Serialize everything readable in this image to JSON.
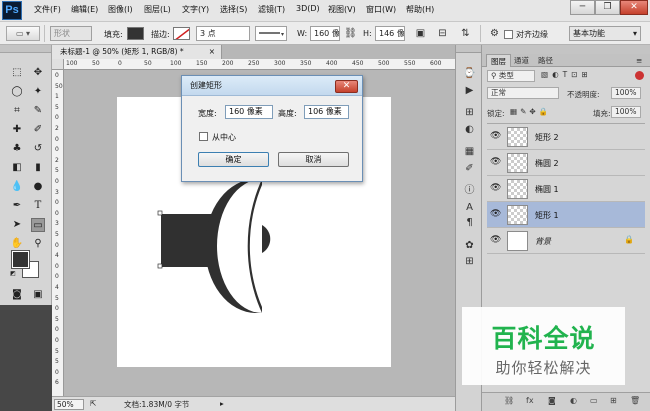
{
  "app": {
    "logo": "Ps"
  },
  "menu": [
    "文件(F)",
    "编辑(E)",
    "图像(I)",
    "图层(L)",
    "文字(Y)",
    "选择(S)",
    "滤镜(T)",
    "3D(D)",
    "视图(V)",
    "窗口(W)",
    "帮助(H)"
  ],
  "window_controls": {
    "minimize": "─",
    "restore": "❐",
    "close": "✕"
  },
  "options": {
    "shape_mode": "形状",
    "fill_label": "填充:",
    "stroke_label": "描边:",
    "stroke_width": "3 点",
    "w_label": "W:",
    "w_value": "160 像",
    "h_label": "H:",
    "h_value": "146 像",
    "align_edges": "对齐边缘",
    "workspace": "基本功能"
  },
  "document": {
    "tab_title": "未标题-1 @ 50% (矩形 1, RGB/8) *",
    "ruler_h": [
      "100",
      "50",
      "0",
      "50",
      "100",
      "150",
      "200",
      "250",
      "300",
      "350",
      "400",
      "450",
      "500",
      "550",
      "600"
    ],
    "ruler_v": [
      "0",
      "50",
      "1",
      "5",
      "0",
      "2",
      "0",
      "0",
      "2",
      "5",
      "0",
      "3",
      "0",
      "0",
      "3",
      "5",
      "0",
      "4",
      "0",
      "0",
      "4",
      "5",
      "0",
      "5",
      "0",
      "0",
      "5",
      "5",
      "0",
      "6"
    ],
    "zoom": "50%",
    "doc_info": "文档:1.83M/0 字节"
  },
  "dialog": {
    "title": "创建矩形",
    "width_label": "宽度:",
    "width_value": "160 像素",
    "height_label": "高度:",
    "height_value": "106 像素",
    "from_center_label": "从中心",
    "ok_label": "确定",
    "cancel_label": "取消",
    "close_glyph": "✕"
  },
  "layers_panel": {
    "tabs": [
      "图层",
      "通道",
      "路径"
    ],
    "kind_label": "类型",
    "blend_mode": "正常",
    "opacity_label": "不透明度:",
    "opacity_value": "100%",
    "lock_label": "锁定:",
    "fill_label": "填充:",
    "fill_value": "100%",
    "layers": [
      {
        "name": "矩形 2",
        "selected": false,
        "locked": false
      },
      {
        "name": "椭圆 2",
        "selected": false,
        "locked": false
      },
      {
        "name": "椭圆 1",
        "selected": false,
        "locked": false
      },
      {
        "name": "矩形 1",
        "selected": true,
        "locked": false
      },
      {
        "name": "背景",
        "selected": false,
        "locked": true
      }
    ]
  },
  "watermark": {
    "title": "百科全说",
    "subtitle": "助你轻松解决"
  },
  "colors": {
    "foreground": "#333333",
    "background": "#ffffff",
    "shape_fill": "#303030",
    "watermark_green": "#21b34e"
  }
}
